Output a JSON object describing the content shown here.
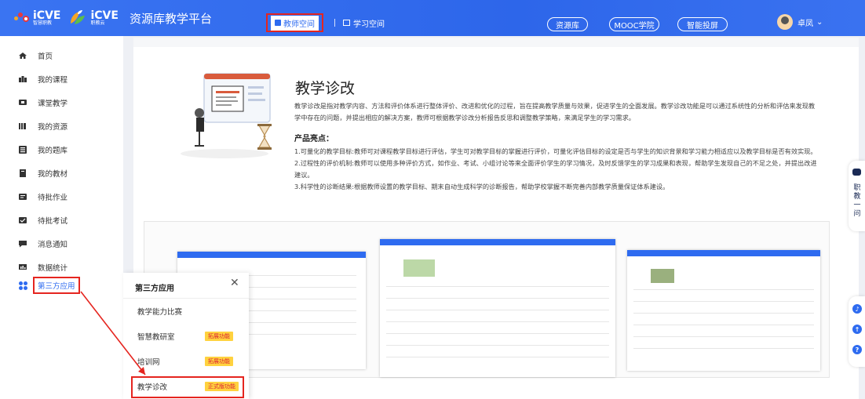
{
  "header": {
    "logo1_text": "iCVE",
    "logo1_sub": "智慧职教",
    "logo2_text": "iCVE",
    "logo2_sub": "职教云",
    "platform_name": "资源库教学平台",
    "tab_teacher": "教师空间",
    "tab_student": "学习空间",
    "pill_resource": "资源库",
    "pill_mooc": "MOOC学院",
    "pill_screen": "智能投屏",
    "user_name": "卓凤",
    "user_caret": "⌄",
    "colors": {
      "header_blue": "#2f6df0",
      "highlight_red": "#e5251f"
    }
  },
  "sidebar": {
    "items": [
      {
        "label": "首页",
        "icon": "home-icon"
      },
      {
        "label": "我的课程",
        "icon": "course-icon"
      },
      {
        "label": "课堂教学",
        "icon": "classroom-icon"
      },
      {
        "label": "我的资源",
        "icon": "resource-icon"
      },
      {
        "label": "我的题库",
        "icon": "question-bank-icon"
      },
      {
        "label": "我的教材",
        "icon": "textbook-icon"
      },
      {
        "label": "待批作业",
        "icon": "homework-icon"
      },
      {
        "label": "待批考试",
        "icon": "exam-icon"
      },
      {
        "label": "消息通知",
        "icon": "message-icon"
      },
      {
        "label": "数据统计",
        "icon": "statistics-icon"
      },
      {
        "label": "第三方应用",
        "icon": "apps-grid-icon"
      }
    ]
  },
  "main": {
    "title": "教学诊改",
    "description": "教学诊改是指对教学内容、方法和评价体系进行整体评价、改进和优化的过程，旨在提高教学质量与效果，促进学生的全面发展。教学诊改功能是可以通过系统性的分析和评估来发现教学中存在的问题，并提出相应的解决方案，教师可根据教学诊改分析报告反思和调整教学策略，来满足学生的学习需求。",
    "highlight_title": "产品亮点：",
    "points": [
      "1.可量化的教学目标:教师可对课程教学目标进行评估，学生可对教学目标的掌握进行评价，可量化评估目标的设定是否与学生的知识背景和学习能力相适应以及教学目标是否有效实现。",
      "2.过程性的评价机制:教师可以使用多种评价方式，如作业、考试、小组讨论等来全面评价学生的学习情况，及时反馈学生的学习成果和表现，帮助学生发现自己的不足之处，并提出改进建议。",
      "3.科学性的诊断结果:根据教师设置的教学目标、期末自动生成科学的诊断报告，帮助学校掌握不断完善内部教学质量保证体系建设。"
    ]
  },
  "float_tab": {
    "label": "职教一问"
  },
  "popup": {
    "title": "第三方应用",
    "close": "✕",
    "items": [
      {
        "label": "教学能力比赛",
        "badge": ""
      },
      {
        "label": "智慧教研室",
        "badge": "拓展功能"
      },
      {
        "label": "培训网",
        "badge": "拓展功能"
      },
      {
        "label": "教学诊改",
        "badge": "正式版功能"
      }
    ]
  }
}
